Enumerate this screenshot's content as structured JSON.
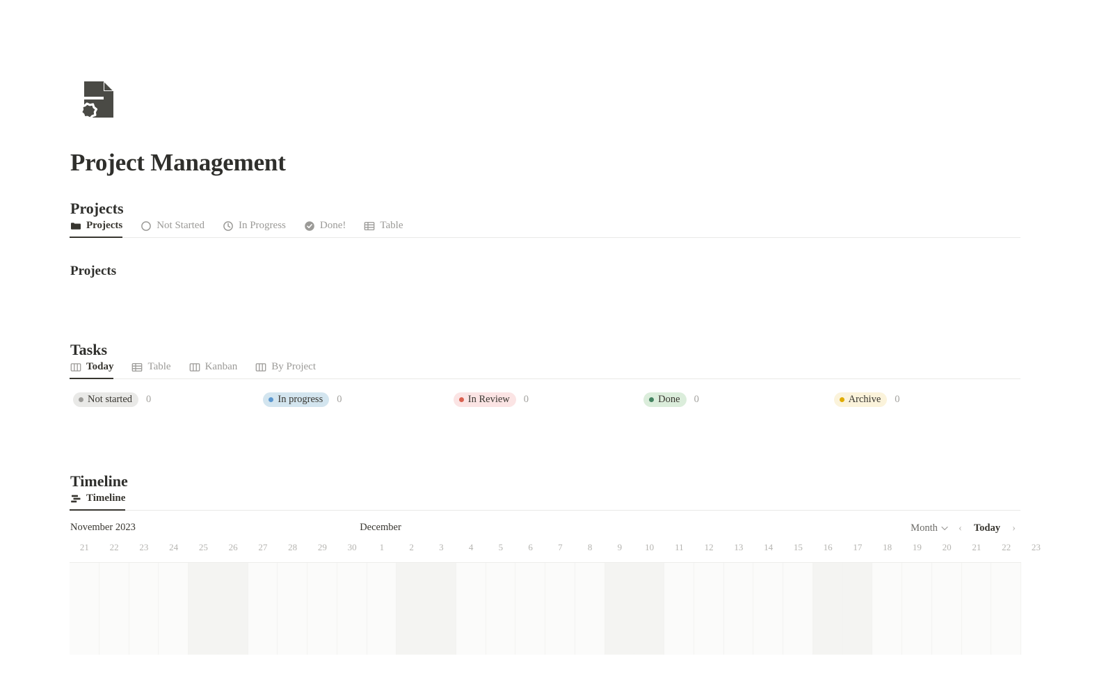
{
  "page": {
    "icon_name": "document-gear-icon",
    "title": "Project Management"
  },
  "projects_section": {
    "heading": "Projects",
    "tabs": [
      {
        "label": "Projects",
        "icon": "folder-icon",
        "active": true
      },
      {
        "label": "Not Started",
        "icon": "circle-icon",
        "active": false
      },
      {
        "label": "In Progress",
        "icon": "clock-icon",
        "active": false
      },
      {
        "label": "Done!",
        "icon": "check-circle-icon",
        "active": false
      },
      {
        "label": "Table",
        "icon": "table-icon",
        "active": false
      }
    ],
    "group_heading": "Projects"
  },
  "tasks_section": {
    "heading": "Tasks",
    "tabs": [
      {
        "label": "Today",
        "icon": "kanban-icon",
        "active": true
      },
      {
        "label": "Table",
        "icon": "table-icon",
        "active": false
      },
      {
        "label": "Kanban",
        "icon": "kanban-icon",
        "active": false
      },
      {
        "label": "By Project",
        "icon": "kanban-icon",
        "active": false
      }
    ],
    "columns": [
      {
        "label": "Not started",
        "count": "0",
        "dot": "#9b9a97",
        "bg": "#e9e9e7"
      },
      {
        "label": "In progress",
        "count": "0",
        "dot": "#5b97cf",
        "bg": "#d3e5ef"
      },
      {
        "label": "In Review",
        "count": "0",
        "dot": "#d9604f",
        "bg": "#fbe4e4"
      },
      {
        "label": "Done",
        "count": "0",
        "dot": "#448361",
        "bg": "#dbeddb"
      },
      {
        "label": "Archive",
        "count": "0",
        "dot": "#dfab01",
        "bg": "#fbf3db"
      }
    ]
  },
  "timeline_section": {
    "heading": "Timeline",
    "tabs": [
      {
        "label": "Timeline",
        "icon": "timeline-icon",
        "active": true
      }
    ],
    "month_left": "November 2023",
    "month_mid": "December",
    "scale_label": "Month",
    "today_label": "Today",
    "prev_label": "‹",
    "next_label": "›",
    "days": [
      {
        "n": "21",
        "weekend": false
      },
      {
        "n": "22",
        "weekend": false
      },
      {
        "n": "23",
        "weekend": false
      },
      {
        "n": "24",
        "weekend": false
      },
      {
        "n": "25",
        "weekend": true
      },
      {
        "n": "26",
        "weekend": true
      },
      {
        "n": "27",
        "weekend": false
      },
      {
        "n": "28",
        "weekend": false
      },
      {
        "n": "29",
        "weekend": false
      },
      {
        "n": "30",
        "weekend": false
      },
      {
        "n": "1",
        "weekend": false
      },
      {
        "n": "2",
        "weekend": true
      },
      {
        "n": "3",
        "weekend": true
      },
      {
        "n": "4",
        "weekend": false
      },
      {
        "n": "5",
        "weekend": false
      },
      {
        "n": "6",
        "weekend": false
      },
      {
        "n": "7",
        "weekend": false
      },
      {
        "n": "8",
        "weekend": false
      },
      {
        "n": "9",
        "weekend": true
      },
      {
        "n": "10",
        "weekend": true
      },
      {
        "n": "11",
        "weekend": false
      },
      {
        "n": "12",
        "weekend": false
      },
      {
        "n": "13",
        "weekend": false
      },
      {
        "n": "14",
        "weekend": false
      },
      {
        "n": "15",
        "weekend": false
      },
      {
        "n": "16",
        "weekend": true
      },
      {
        "n": "17",
        "weekend": true
      },
      {
        "n": "18",
        "weekend": false
      },
      {
        "n": "19",
        "weekend": false
      },
      {
        "n": "20",
        "weekend": false
      },
      {
        "n": "21",
        "weekend": false
      },
      {
        "n": "22",
        "weekend": false
      },
      {
        "n": "23",
        "weekend": true
      }
    ]
  }
}
